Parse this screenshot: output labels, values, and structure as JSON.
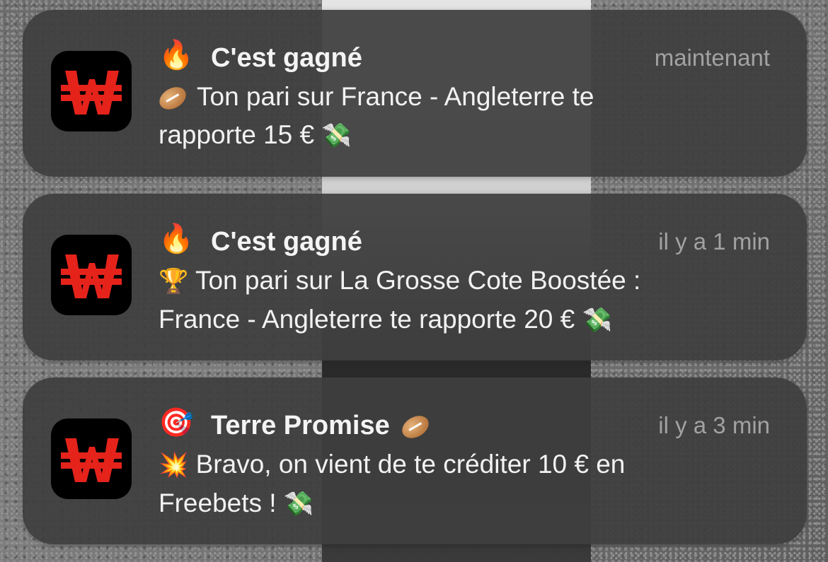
{
  "notifications": [
    {
      "title": "C'est gagné",
      "title_emoji": "fire-icon",
      "time": "maintenant",
      "body_icon": "rugby-ball-icon",
      "line1": "Ton pari sur France - Angleterre te",
      "line2": "rapporte 15 €",
      "end_icon": "money-with-wings-icon"
    },
    {
      "title": "C'est gagné",
      "title_emoji": "fire-icon",
      "time": "il y a 1 min",
      "body_icon": "trophy-icon",
      "line1": "Ton pari sur La Grosse Cote Boostée :",
      "line2": "France - Angleterre te rapporte 20 €",
      "end_icon": "money-with-wings-icon"
    },
    {
      "title": "Terre Promise",
      "title_emoji": "dart-target-icon",
      "title_end_icon": "rugby-ball-icon",
      "time": "il y a 3 min",
      "body_icon": "collision-icon",
      "line1": "Bravo, on vient de te créditer 10 € en",
      "line2": "Freebets !",
      "end_icon": "money-with-wings-icon"
    }
  ],
  "app": {
    "icon": "winamax-w-logo",
    "icon_color": "#e5231b",
    "icon_bg": "#000000"
  }
}
